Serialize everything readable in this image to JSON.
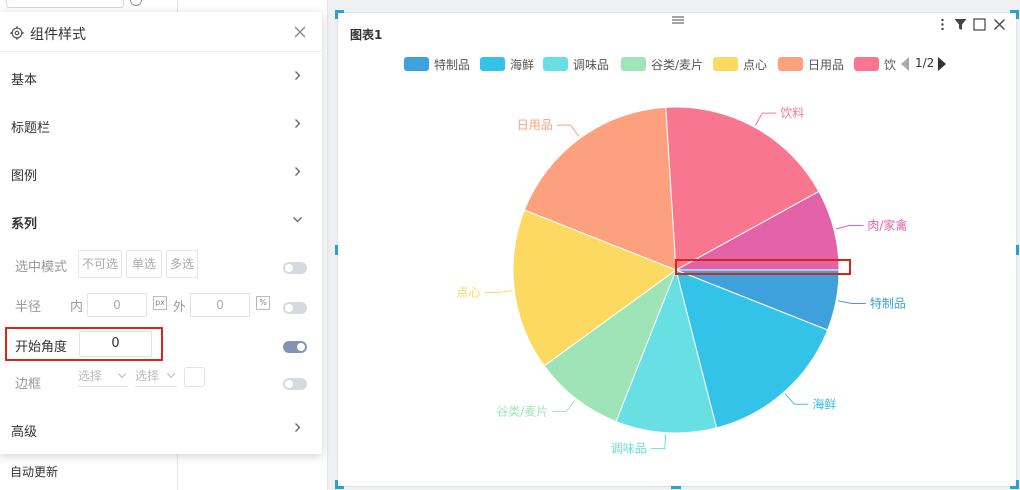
{
  "background": {
    "auto_update_label": "自动更新"
  },
  "panel": {
    "title": "组件样式",
    "sections": {
      "basic": "基本",
      "title_bar": "标题栏",
      "legend": "图例",
      "series": "系列",
      "advanced": "高级"
    },
    "selection_mode": {
      "label": "选中模式",
      "options": [
        "不可选",
        "单选",
        "多选"
      ]
    },
    "radius": {
      "label": "半径",
      "inner_label": "内",
      "inner_value": "0",
      "outer_label": "外",
      "outer_value": "0",
      "inner_unit": "px",
      "outer_unit": "%"
    },
    "start_angle": {
      "label": "开始角度",
      "value": "0"
    },
    "border": {
      "label": "边框",
      "select1": "选择",
      "select2": "选择"
    }
  },
  "chart": {
    "title": "图表1",
    "pager": "1/2",
    "legend_truncated": "饮",
    "colors": {
      "accent": "#2aa0d8",
      "highlight": "#d8261f"
    }
  },
  "chart_data": {
    "type": "pie",
    "title": "图表1",
    "start_angle": 0,
    "legend_placement": "top",
    "slices": [
      {
        "name": "特制品",
        "value": 6.0,
        "color": "#3ea1db"
      },
      {
        "name": "海鲜",
        "value": 15.0,
        "color": "#33c3e8"
      },
      {
        "name": "调味品",
        "value": 10.0,
        "color": "#68dfe2"
      },
      {
        "name": "谷类/麦片",
        "value": 9.0,
        "color": "#9fe4b7"
      },
      {
        "name": "点心",
        "value": 16.0,
        "color": "#fcd960"
      },
      {
        "name": "日用品",
        "value": 18.0,
        "color": "#fca07e"
      },
      {
        "name": "饮料",
        "value": 18.0,
        "color": "#f97690"
      },
      {
        "name": "肉/家禽",
        "value": 8.0,
        "color": "#e263a8"
      }
    ]
  }
}
